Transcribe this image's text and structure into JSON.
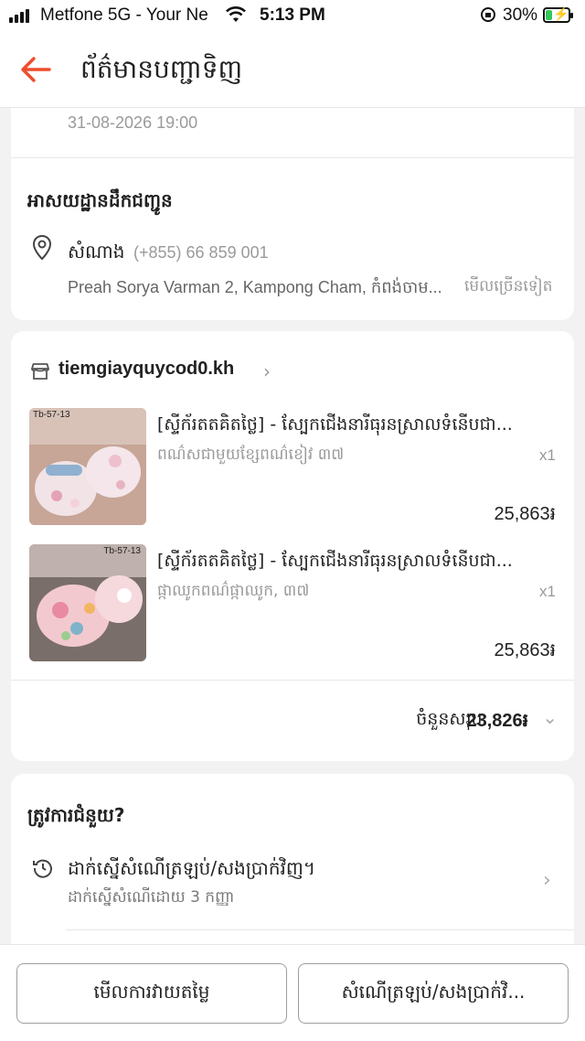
{
  "status_bar": {
    "carrier": "Metfone 5G - Your Ne",
    "time": "5:13 PM",
    "battery_percent": "30%",
    "battery_level": 0.3
  },
  "nav": {
    "title": "ព័ត៌មានបញ្ជាទិញ"
  },
  "order_info": {
    "date": "31-08-2026 19:00"
  },
  "delivery": {
    "title": "អាសយដ្ឋានដឹកជញ្ជូន",
    "recipient": "សំណាង",
    "phone": "(+855) 66 859 001",
    "address": "Preah Sorya Varman 2, Kampong Cham, កំពង់ចាម...",
    "see_more": "មើលច្រើនទៀត"
  },
  "shop": {
    "name": "tiemgiayquycod0.kh",
    "products": [
      {
        "title": "[ស្ទីក័រតតគិតថ្លៃ] - ស្បែកជើងនារីធុរនស្រាលទំនើបជា...",
        "variant": "ពណ៌សជាមួយខ្សែពណ៌ខៀវ ៣៧",
        "qty": "x1",
        "price": "25,863៛",
        "thumb_tag": "Tb-57-13"
      },
      {
        "title": "[ស្ទីក័រតតគិតថ្លៃ] - ស្បែកជើងនារីធុរនស្រាលទំនើបជា...",
        "variant": "ផ្កាឈូកពណ៌ផ្កាឈូក, ៣៧",
        "qty": "x1",
        "price": "25,863៛",
        "thumb_tag": "Tb-57-13"
      }
    ],
    "total_label": "ចំនួនសរុប:",
    "total_value": "23,826៛"
  },
  "help": {
    "title": "ត្រូវការជំនួយ?",
    "item_main": "ដាក់ស្នើសំណើត្រឡប់/សងប្រាក់វិញ។",
    "item_sub": "ដាក់ស្នើសំណើដោយ 3 កញ្ញា"
  },
  "bottom": {
    "left_button": "មើលការវាយតម្លៃ",
    "right_button": "សំណើត្រឡប់/សងប្រាក់វិ..."
  },
  "colors": {
    "accent": "#ee4d2d",
    "background": "#f2f2f2",
    "battery": "#34c759"
  },
  "icons": [
    "signal-icon",
    "wifi-icon",
    "rotation-lock-icon",
    "battery-icon",
    "back-arrow-icon",
    "location-pin-icon",
    "shop-icon",
    "chevron-right-icon",
    "chevron-down-icon",
    "return-icon"
  ]
}
